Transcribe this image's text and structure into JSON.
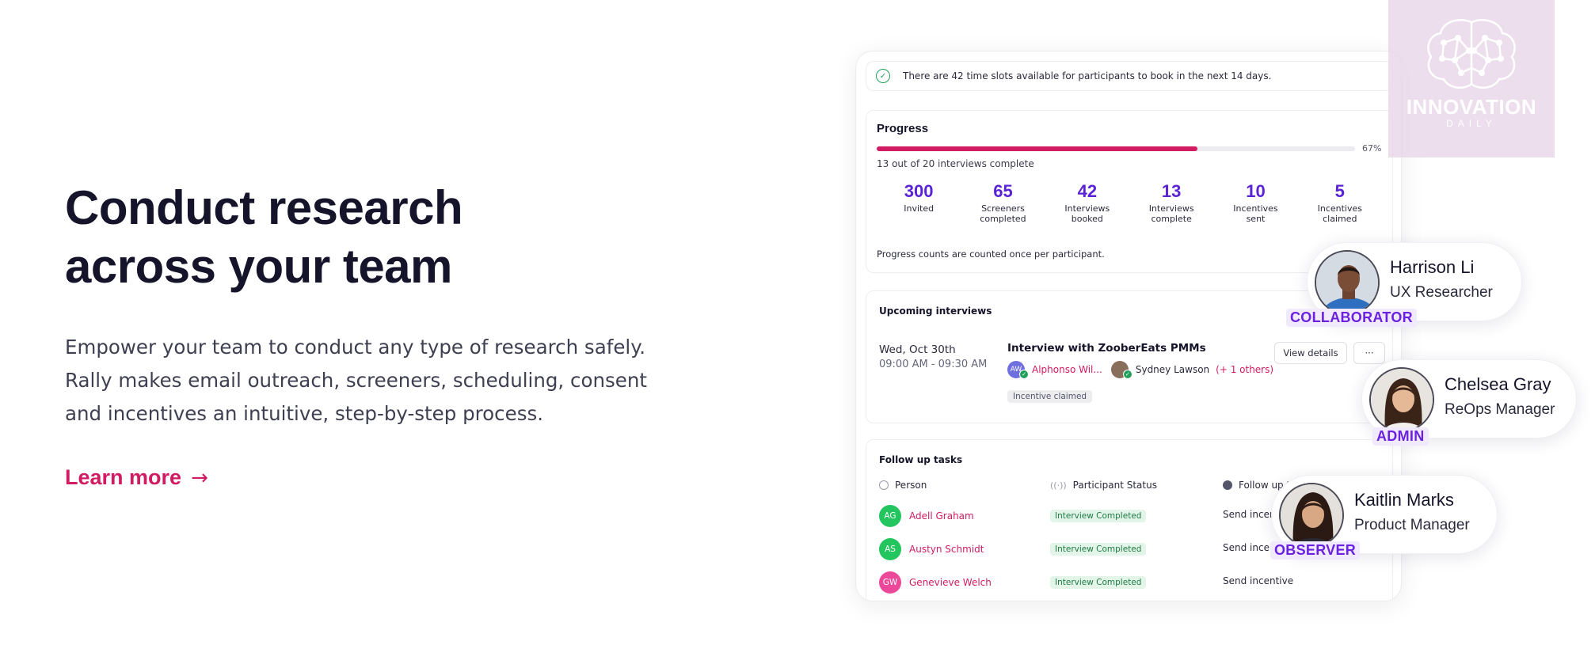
{
  "hero": {
    "title_line1": "Conduct research",
    "title_line2": "across your team",
    "description_line1": "Empower your team to conduct any type of research safely.",
    "description_line2": "Rally makes email outreach, screeners, scheduling, consent",
    "description_line3": "and incentives an intuitive, step-by-step process.",
    "link_label": "Learn more",
    "link_arrow": "→"
  },
  "notice": {
    "text": "There are 42 time slots available for participants to book in the next 14 days."
  },
  "progress": {
    "title": "Progress",
    "fraction": 0.67,
    "percent_label": "67%",
    "subtitle": "13 out of 20 interviews complete",
    "stats": [
      {
        "value": "300",
        "label1": "Invited",
        "label2": ""
      },
      {
        "value": "65",
        "label1": "Screeners",
        "label2": "completed"
      },
      {
        "value": "42",
        "label1": "Interviews",
        "label2": "booked"
      },
      {
        "value": "13",
        "label1": "Interviews",
        "label2": "complete"
      },
      {
        "value": "10",
        "label1": "Incentives",
        "label2": "sent"
      },
      {
        "value": "5",
        "label1": "Incentives",
        "label2": "claimed"
      }
    ],
    "note": "Progress counts are counted once per participant."
  },
  "upcoming": {
    "title": "Upcoming interviews",
    "date": "Wed, Oct 30th",
    "time": "09:00 AM - 09:30 AM",
    "interview_name": "Interview with ZooberEats PMMs",
    "attendee1_initials": "AW",
    "attendee1_name": "Alphonso Wil...",
    "attendee2_name": "Sydney Lawson",
    "others": "(+ 1 others)",
    "tag": "Incentive claimed",
    "view_details": "View details",
    "more": "···"
  },
  "followup": {
    "title": "Follow up tasks",
    "col_person": "Person",
    "col_status": "Participant Status",
    "col_followup": "Follow up t",
    "rows": [
      {
        "initials": "AG",
        "name": "Adell Graham",
        "status": "Interview Completed",
        "action": "Send incent",
        "color": "#22c55e"
      },
      {
        "initials": "AS",
        "name": "Austyn Schmidt",
        "status": "Interview Completed",
        "action": "Send incent",
        "color": "#22c55e"
      },
      {
        "initials": "GW",
        "name": "Genevieve Welch",
        "status": "Interview Completed",
        "action": "Send incentive",
        "color": "#ec4899"
      }
    ]
  },
  "watermark": {
    "title": "INNOVATION",
    "subtitle": "DAILY"
  },
  "people": [
    {
      "name": "Harrison Li",
      "role": "UX Researcher",
      "badge": "COLLABORATOR"
    },
    {
      "name": "Chelsea Gray",
      "role": "ReOps Manager",
      "badge": "ADMIN"
    },
    {
      "name": "Kaitlin Marks",
      "role": "Product Manager",
      "badge": "OBSERVER"
    }
  ],
  "colors": {
    "accent": "#d11b62",
    "stat": "#5a23d6",
    "badge": "#6a22e0",
    "success": "#22a05a"
  }
}
